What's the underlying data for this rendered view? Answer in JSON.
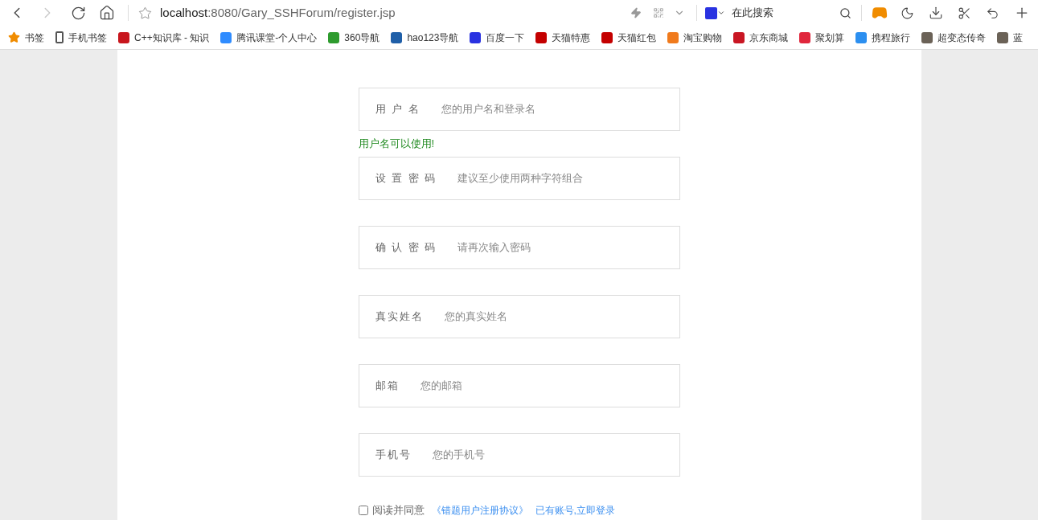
{
  "toolbar": {
    "back_disabled": false,
    "forward_disabled": true,
    "url": {
      "host": "localhost",
      "rest": ":8080/Gary_SSHForum/register.jsp"
    },
    "search": {
      "placeholder": "在此搜索"
    }
  },
  "bookmarks": [
    {
      "kind": "star",
      "label": "书签",
      "color": "#f08c00"
    },
    {
      "kind": "phone",
      "label": "手机书签",
      "color": "#555555"
    },
    {
      "kind": "logo",
      "label": "C++知识库 - 知识",
      "color": "#c8161d"
    },
    {
      "kind": "logo",
      "label": "腾讯课堂-个人中心",
      "color": "#2f8cff"
    },
    {
      "kind": "logo",
      "label": "360导航",
      "color": "#2e9b2e"
    },
    {
      "kind": "logo",
      "label": "hao123导航",
      "color": "#1f5fa8"
    },
    {
      "kind": "logo",
      "label": "百度一下",
      "color": "#2932e1"
    },
    {
      "kind": "logo",
      "label": "天猫特惠",
      "color": "#c40000"
    },
    {
      "kind": "logo",
      "label": "天猫红包",
      "color": "#c40000"
    },
    {
      "kind": "logo",
      "label": "淘宝购物",
      "color": "#f07a1c"
    },
    {
      "kind": "logo",
      "label": "京东商城",
      "color": "#c91623"
    },
    {
      "kind": "logo",
      "label": "聚划算",
      "color": "#e0263c"
    },
    {
      "kind": "logo",
      "label": "携程旅行",
      "color": "#2c8ff0"
    },
    {
      "kind": "logo",
      "label": "超变态传奇",
      "color": "#6b6257"
    },
    {
      "kind": "logo",
      "label": "蓝",
      "color": "#6b6257"
    }
  ],
  "form": {
    "fields": [
      {
        "label": "用 户 名",
        "placeholder": "您的用户名和登录名",
        "hint": "用户名可以使用!"
      },
      {
        "label": "设 置 密 码",
        "placeholder": "建议至少使用两种字符组合"
      },
      {
        "label": "确 认 密 码",
        "placeholder": "请再次输入密码"
      },
      {
        "label": "真实姓名",
        "placeholder": "您的真实姓名"
      },
      {
        "label": "邮箱",
        "placeholder": "您的邮箱"
      },
      {
        "label": "手机号",
        "placeholder": "您的手机号"
      }
    ],
    "agreement": {
      "checked": false,
      "text": "阅读并同意",
      "links": [
        "《错题用户注册协议》",
        "已有账号,立即登录"
      ]
    }
  }
}
